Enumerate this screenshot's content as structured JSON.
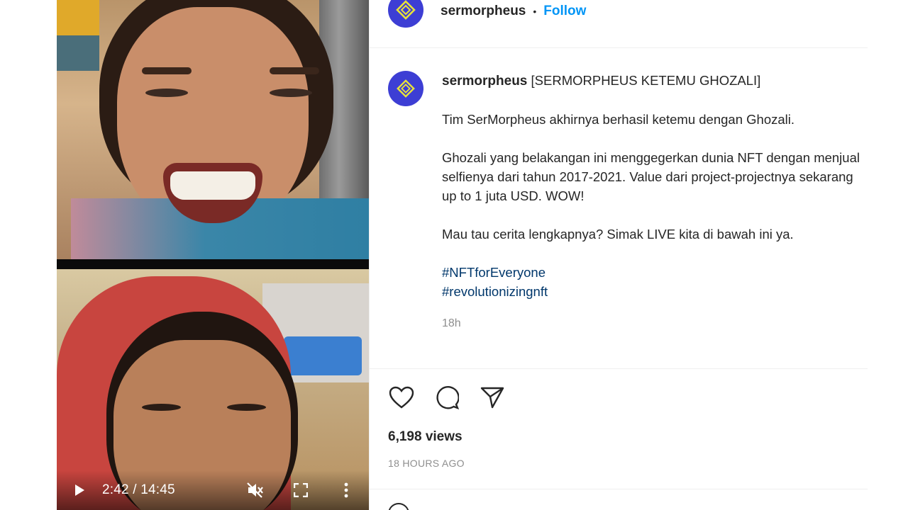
{
  "video": {
    "timecode": "2:42 / 14:45",
    "icons": [
      "play-icon",
      "muted-icon",
      "fullscreen-icon",
      "more-vertical-icon"
    ]
  },
  "header": {
    "username": "sermorpheus",
    "separator": "•",
    "follow_label": "Follow"
  },
  "caption": {
    "username": "sermorpheus",
    "title": "[SERMORPHEUS KETEMU GHOZALI]",
    "paragraph1": "Tim SerMorpheus akhirnya berhasil ketemu dengan Ghozali.",
    "paragraph2": "Ghozali yang belakangan ini menggegerkan dunia NFT dengan menjual selfienya dari tahun 2017-2021. Value dari project-projectnya sekarang up to 1 juta USD. WOW!",
    "paragraph3": "Mau tau cerita lengkapnya? Simak LIVE kita di bawah ini ya.",
    "hashtags": [
      "#NFTforEveryone",
      "#revolutionizingnft"
    ],
    "time_ago": "18h"
  },
  "actions": {
    "icons": [
      "heart-icon",
      "comment-icon",
      "share-icon"
    ]
  },
  "stats": {
    "views": "6,198 views",
    "posted": "18 HOURS AGO"
  },
  "colors": {
    "brand_avatar": "#3d3ed4",
    "follow_blue": "#0095f6",
    "hashtag": "#00376b",
    "muted_text": "#8e8e8e"
  }
}
